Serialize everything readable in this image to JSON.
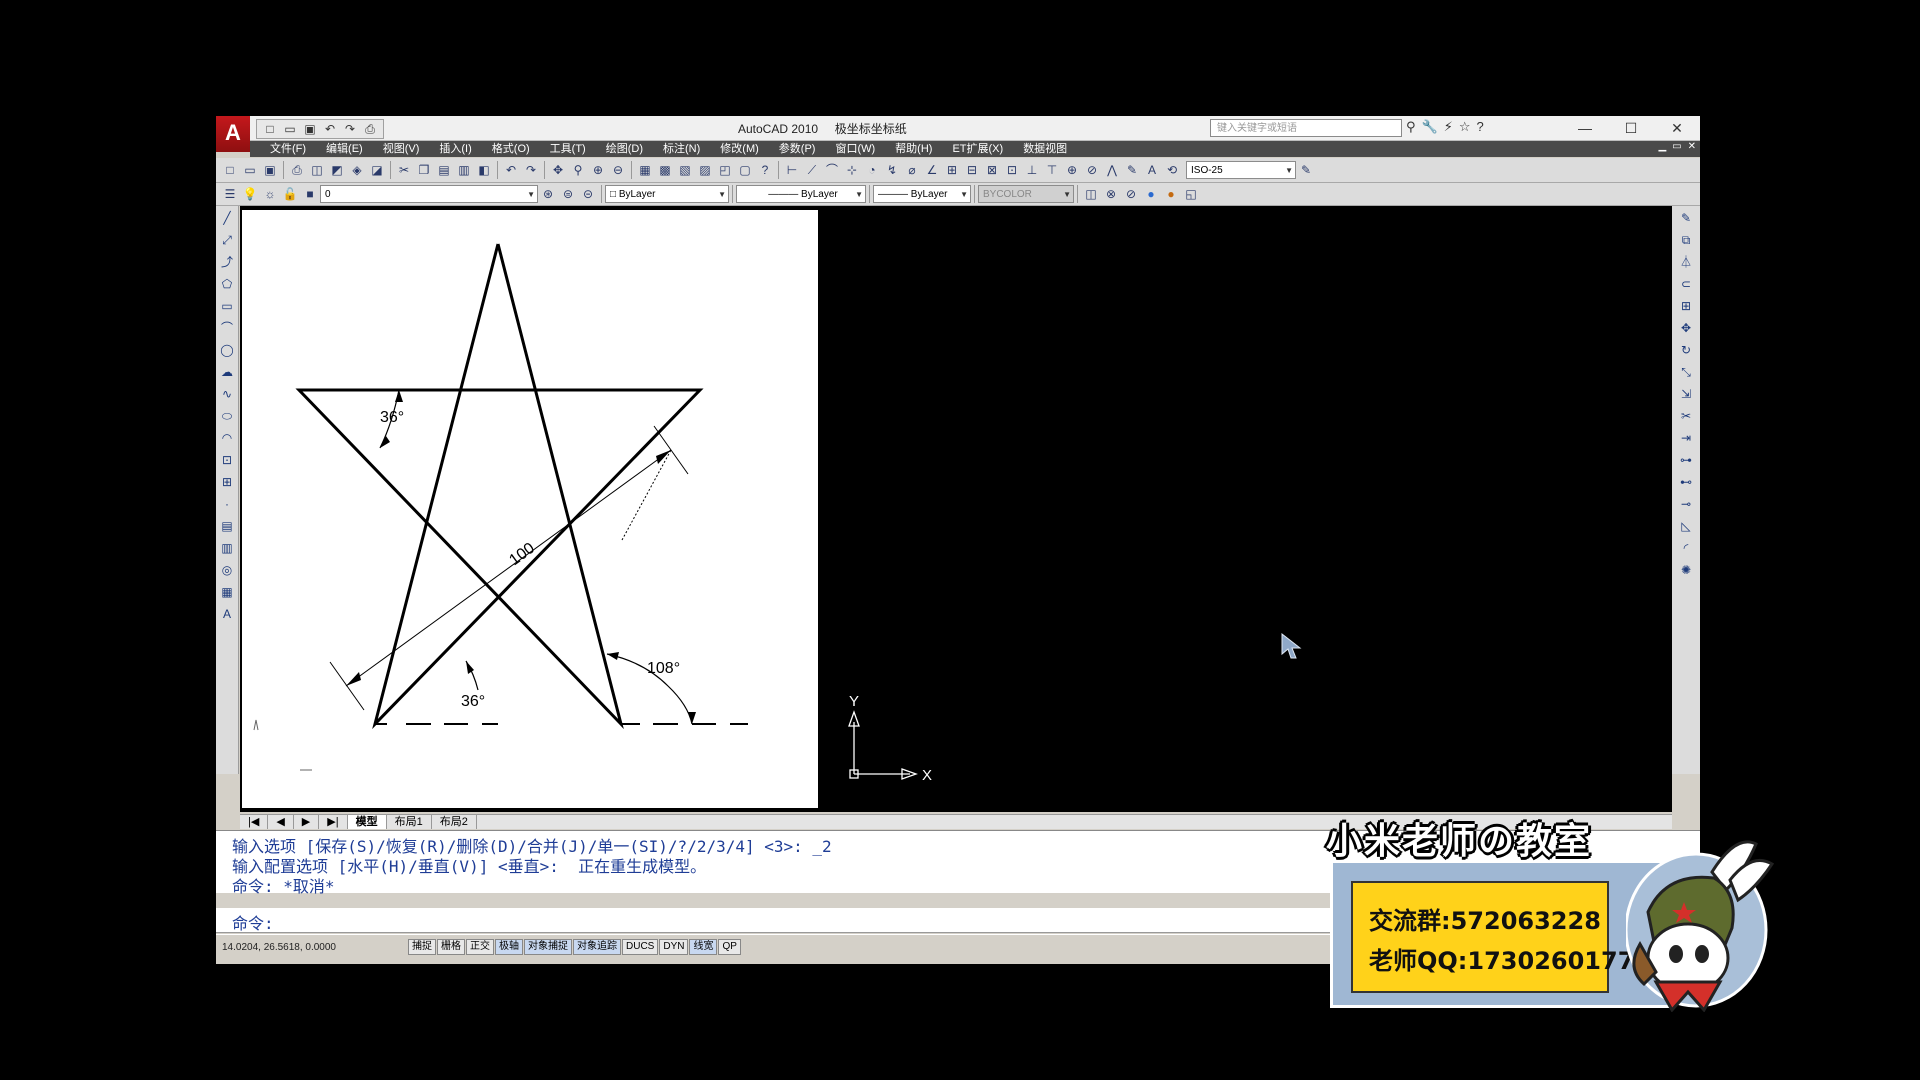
{
  "window": {
    "title": "AutoCAD 2010",
    "file_name": "极坐标坐标纸",
    "search_placeholder": "键入关键字或短语",
    "controls": [
      "—",
      "☐",
      "✕"
    ]
  },
  "quick_access": [
    "□",
    "▭",
    "▣",
    "↶",
    "↷",
    "⎙"
  ],
  "menu": [
    "文件(F)",
    "编辑(E)",
    "视图(V)",
    "插入(I)",
    "格式(O)",
    "工具(T)",
    "绘图(D)",
    "标注(N)",
    "修改(M)",
    "参数(P)",
    "窗口(W)",
    "帮助(H)",
    "ET扩展(X)",
    "数据视图"
  ],
  "mdi_controls": [
    "▁",
    "▭",
    "✕"
  ],
  "toolbar": {
    "dimstyle": "ISO-25",
    "layer": "0",
    "color": "ByLayer",
    "linetype": "ByLayer",
    "lineweight": "ByLayer",
    "plotstyle": "BYCOLOR"
  },
  "drawing": {
    "dim_length": "100",
    "angle_top": "36°",
    "angle_bottom": "36°",
    "angle_exterior": "108°",
    "ucs_x": "X",
    "ucs_y": "Y"
  },
  "layout_tabs": [
    "模型",
    "布局1",
    "布局2"
  ],
  "command": {
    "line1": "输入选项 [保存(S)/恢复(R)/删除(D)/合并(J)/单一(SI)/?/2/3/4] <3>: _2",
    "line2": "输入配置选项 [水平(H)/垂直(V)] <垂直>:  正在重生成模型。",
    "line3": "命令: *取消*",
    "prompt": "命令:"
  },
  "status": {
    "coords": "14.0204, 26.5618, 0.0000",
    "buttons": [
      "捕捉",
      "栅格",
      "正交",
      "极轴",
      "对象捕捉",
      "对象追踪",
      "DUCS",
      "DYN",
      "线宽",
      "QP"
    ]
  },
  "overlay": {
    "title": "小米老师の教室",
    "group": "交流群:572063228",
    "qq": "老师QQ:1730260177"
  }
}
